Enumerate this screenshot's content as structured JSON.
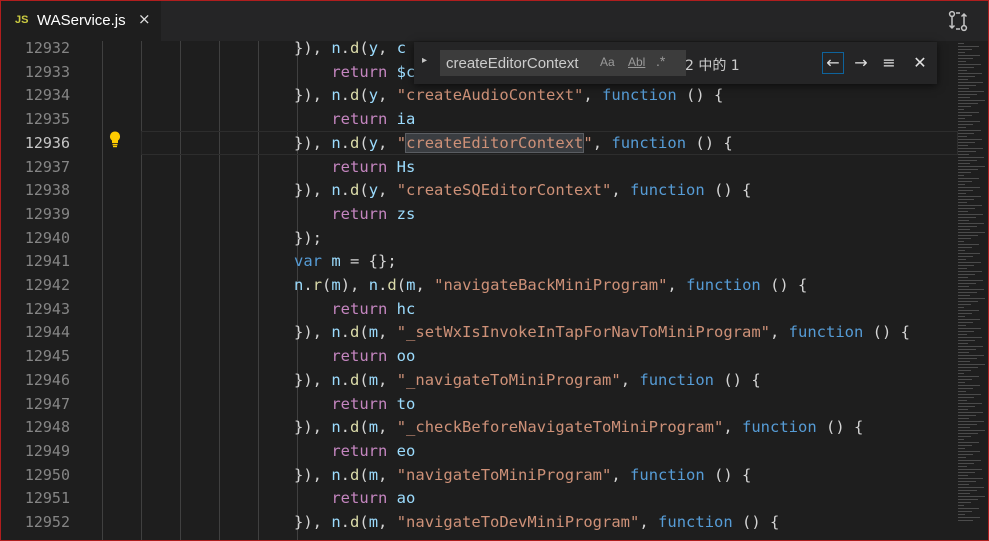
{
  "tab": {
    "badge": "JS",
    "file_name": "WAService.js",
    "close_glyph": "×",
    "icon": "js-file-icon"
  },
  "toolbar": {
    "compare_icon": "open-changes-icon"
  },
  "find": {
    "expand_glyph": "▸",
    "query": "createEditorContext",
    "match_case_label": "Aa",
    "whole_word_label": "Abl",
    "regex_label": ".*",
    "count": "2 中的 1",
    "prev_glyph": "←",
    "next_glyph": "→",
    "selection_glyph": "≡",
    "close_glyph": "✕"
  },
  "editor": {
    "current_line": "12936",
    "colors": {
      "keyword": "#569cd6",
      "string": "#ce9178",
      "control": "#c586c0",
      "function": "#dcdcaa",
      "variable": "#9cdcfe"
    },
    "lines": [
      {
        "num": "12932",
        "code": "}), n.d(y, \"c"
      },
      {
        "num": "12933",
        "code": "    return $c"
      },
      {
        "num": "12934",
        "code": "}), n.d(y, \"createAudioContext\", function () {"
      },
      {
        "num": "12935",
        "code": "    return ia"
      },
      {
        "num": "12936",
        "code": "}), n.d(y, \"createEditorContext\", function () {"
      },
      {
        "num": "12937",
        "code": "    return Hs"
      },
      {
        "num": "12938",
        "code": "}), n.d(y, \"createSQEditorContext\", function () {"
      },
      {
        "num": "12939",
        "code": "    return zs"
      },
      {
        "num": "12940",
        "code": "});"
      },
      {
        "num": "12941",
        "code": "var m = {};"
      },
      {
        "num": "12942",
        "code": "n.r(m), n.d(m, \"navigateBackMiniProgram\", function () {"
      },
      {
        "num": "12943",
        "code": "    return hc"
      },
      {
        "num": "12944",
        "code": "}), n.d(m, \"_setWxIsInvokeInTapForNavToMiniProgram\", function () {"
      },
      {
        "num": "12945",
        "code": "    return oo"
      },
      {
        "num": "12946",
        "code": "}), n.d(m, \"_navigateToMiniProgram\", function () {"
      },
      {
        "num": "12947",
        "code": "    return to"
      },
      {
        "num": "12948",
        "code": "}), n.d(m, \"_checkBeforeNavigateToMiniProgram\", function () {"
      },
      {
        "num": "12949",
        "code": "    return eo"
      },
      {
        "num": "12950",
        "code": "}), n.d(m, \"navigateToMiniProgram\", function () {"
      },
      {
        "num": "12951",
        "code": "    return ao"
      },
      {
        "num": "12952",
        "code": "}), n.d(m, \"navigateToDevMiniProgram\", function () {"
      }
    ]
  }
}
